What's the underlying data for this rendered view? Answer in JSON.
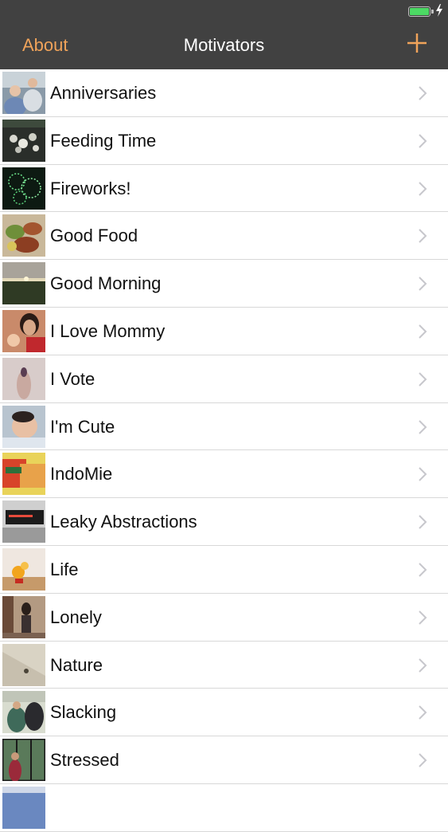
{
  "nav": {
    "about_label": "About",
    "title": "Motivators",
    "add_icon": "plus-icon",
    "accent_color": "#f0a35a"
  },
  "status": {
    "battery_color": "#4cd964",
    "battery_level": 1.0,
    "charging": true
  },
  "motivators": [
    {
      "label": "Anniversaries"
    },
    {
      "label": "Feeding Time"
    },
    {
      "label": "Fireworks!"
    },
    {
      "label": "Good Food"
    },
    {
      "label": "Good Morning"
    },
    {
      "label": "I Love Mommy"
    },
    {
      "label": "I Vote"
    },
    {
      "label": "I'm Cute"
    },
    {
      "label": "IndoMie"
    },
    {
      "label": "Leaky Abstractions"
    },
    {
      "label": "Life"
    },
    {
      "label": "Lonely"
    },
    {
      "label": "Nature"
    },
    {
      "label": "Slacking"
    },
    {
      "label": "Stressed"
    },
    {
      "label": ""
    }
  ]
}
